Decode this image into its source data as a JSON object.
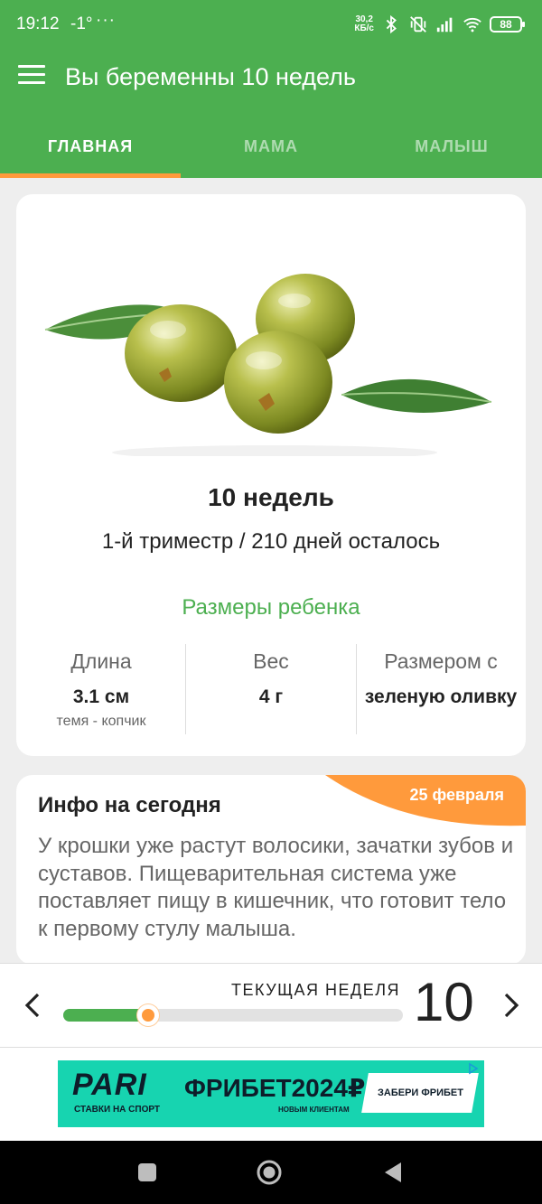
{
  "status_bar": {
    "time": "19:12",
    "temperature": "-1°",
    "dots": "···",
    "net_speed_value": "30,2",
    "net_speed_unit": "КБ/с",
    "battery": "88"
  },
  "app_bar": {
    "title": "Вы беременны 10 недель",
    "menu_icon": "hamburger-icon",
    "color": "#4caf50"
  },
  "tabs": [
    {
      "label": "ГЛАВНАЯ",
      "active": true
    },
    {
      "label": "МАМА",
      "active": false
    },
    {
      "label": "МАЛЫШ",
      "active": false
    }
  ],
  "main_card": {
    "image": "olives-image",
    "week_title": "10 недель",
    "trimester_line": "1-й триместр / 210 дней осталось",
    "sizes_title": "Размеры ребенка",
    "stats": [
      {
        "label": "Длина",
        "value": "3.1 см",
        "sub": "темя - копчик"
      },
      {
        "label": "Вес",
        "value": "4 г",
        "sub": ""
      },
      {
        "label": "Размером с",
        "value": "зеленую оливку",
        "sub": ""
      }
    ]
  },
  "info_card": {
    "title": "Инфо на сегодня",
    "date": "25 февраля",
    "text": "У крошки уже растут волосики, зачатки зубов и суставов. Пищеварительная система уже поставляет пищу в кишечник, что готовит тело к первому стулу малыша."
  },
  "week_selector": {
    "label": "ТЕКУЩАЯ НЕДЕЛЯ",
    "week": "10",
    "progress_fraction": 0.25
  },
  "ad": {
    "brand": "PARI",
    "brand_sub": "СТАВКИ НА СПОРТ",
    "headline": "ФРИБЕТ2024₽",
    "headline_sub": "НОВЫМ КЛИЕНТАМ",
    "cta": "ЗАБЕРИ ФРИБЕТ"
  },
  "nav_bar": {
    "buttons": [
      "recent-apps-icon",
      "home-icon",
      "back-icon"
    ]
  },
  "colors": {
    "primary": "#4caf50",
    "accent": "#ff9a3c",
    "ad_bg": "#17d4b0"
  }
}
